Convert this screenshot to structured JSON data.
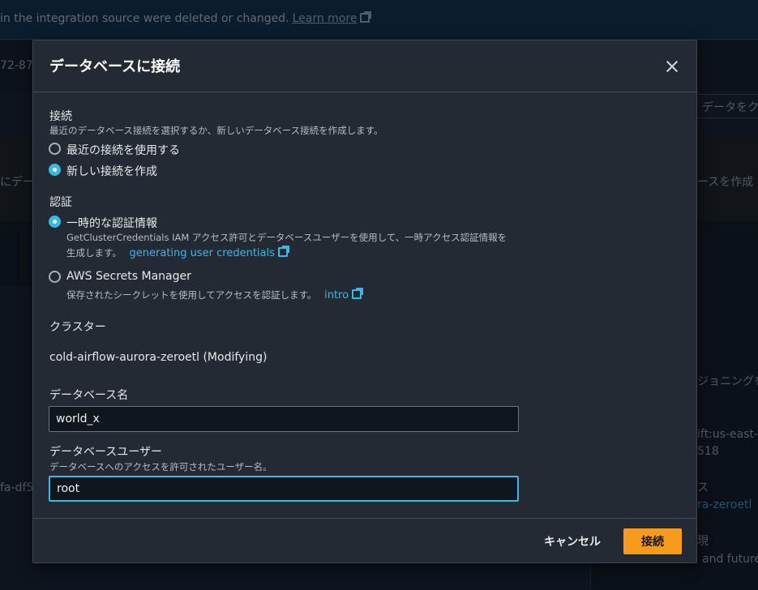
{
  "background": {
    "banner_text": "in the integration source were deleted or changed.",
    "banner_link": "Learn more",
    "left_id": "72-87",
    "right_button": "データをク",
    "left_frag1": "にデー",
    "right_frag1": "ースを作成",
    "right_frag2": "ジョニングを",
    "right_frag3": "ift:us-east-",
    "right_frag4": "518",
    "left_frag2": "fa-df57",
    "right_frag5": "ス",
    "right_frag6": "ra-zeroetl",
    "right_frag7": "現",
    "right_frag8": "and future"
  },
  "modal": {
    "title": "データベースに接続",
    "connection": {
      "label": "接続",
      "description": "最近のデータベース接続を選択するか、新しいデータベース接続を作成します。",
      "options": [
        {
          "label": "最近の接続を使用する",
          "checked": false
        },
        {
          "label": "新しい接続を作成",
          "checked": true
        }
      ]
    },
    "auth": {
      "label": "認証",
      "option_temp": {
        "label": "一時的な認証情報",
        "desc_line1": "GetClusterCredentials IAM アクセス許可とデータベースユーザーを使用して、一時アクセス認証情報を",
        "desc_line2": "生成します。",
        "link": "generating user credentials"
      },
      "option_secrets": {
        "label": "AWS Secrets Manager",
        "desc": "保存されたシークレットを使用してアクセスを認証します。",
        "link": "intro"
      }
    },
    "cluster": {
      "label": "クラスター",
      "value": "cold-airflow-aurora-zeroetl (Modifying)"
    },
    "database_name": {
      "label": "データベース名",
      "value": "world_x"
    },
    "database_user": {
      "label": "データベースユーザー",
      "description": "データベースへのアクセスを許可されたユーザー名。",
      "value": "root"
    },
    "footer": {
      "cancel": "キャンセル",
      "connect": "接続"
    }
  }
}
